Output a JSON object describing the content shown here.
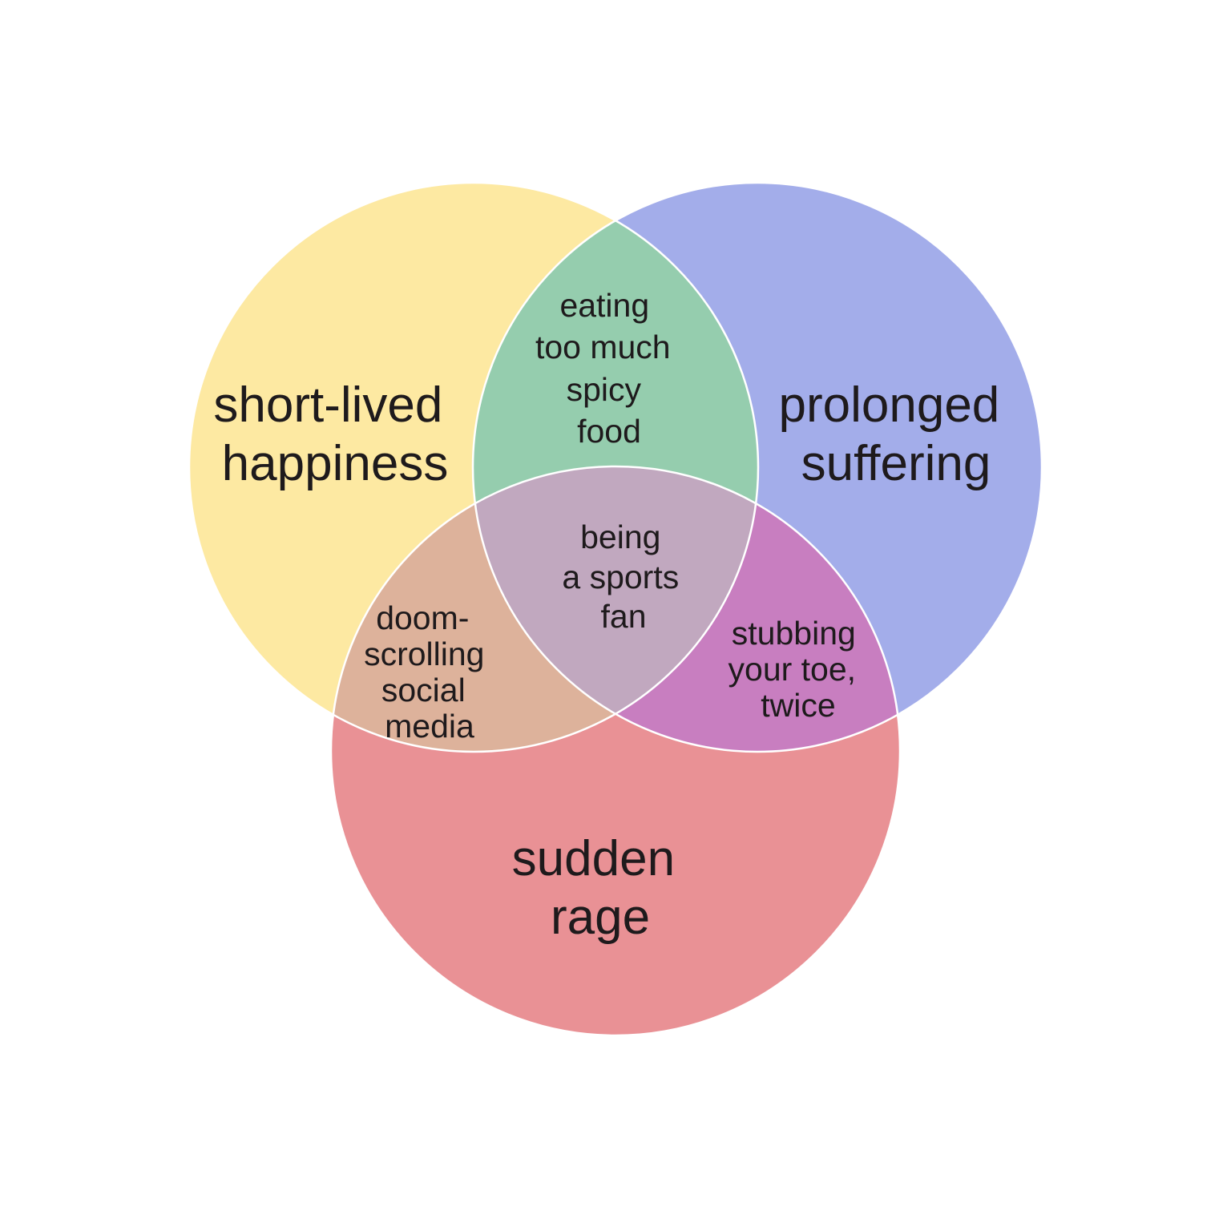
{
  "diagram": {
    "type": "venn-3",
    "colors": {
      "short_lived_happiness": "#fde9a2",
      "prolonged_suffering": "#a3adea",
      "sudden_rage": "#e99195",
      "eating_spicy_food": "#95cdae",
      "doomscrolling": "#ddb29b",
      "stubbing_toe": "#c87ec0",
      "sports_fan": "#c1a8bf",
      "outline": "#ffffff",
      "text": "#1e1a1c"
    },
    "sets": {
      "short_lived_happiness": {
        "lines": [
          "short-lived",
          "happiness"
        ]
      },
      "prolonged_suffering": {
        "lines": [
          "prolonged",
          "suffering"
        ]
      },
      "sudden_rage": {
        "lines": [
          "sudden",
          "rage"
        ]
      }
    },
    "intersections": {
      "eating_spicy_food": {
        "lines": [
          "eating",
          "too much",
          "spicy",
          "food"
        ]
      },
      "doomscrolling": {
        "lines": [
          "doom-",
          "scrolling",
          "social",
          "media"
        ]
      },
      "stubbing_toe": {
        "lines": [
          "stubbing",
          "your toe,",
          "twice"
        ]
      },
      "sports_fan": {
        "lines": [
          "being",
          "a sports",
          "fan"
        ]
      }
    }
  }
}
